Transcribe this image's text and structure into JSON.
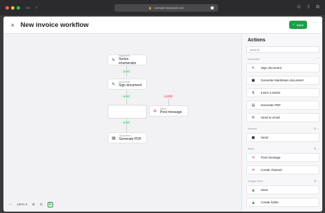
{
  "browser": {
    "url": "console.hexavoir.com",
    "lock": "🔒"
  },
  "header": {
    "close": "×",
    "title": "New invoice workflow",
    "save_label": "Save",
    "save_icon": "✓",
    "more": "···"
  },
  "canvas": {
    "nodes": [
      {
        "category": "Document",
        "label": "Series enumerator",
        "icon": "✎"
      },
      {
        "category": "Document",
        "label": "Sign document",
        "icon": "✎"
      },
      {
        "category": "Slack",
        "label": "Post message",
        "icon": "✲"
      },
      {
        "category": "Document",
        "label": "Generate PDF",
        "icon": "▤"
      }
    ],
    "badges": {
      "ok": "● OK",
      "err": "● ERR"
    },
    "zoom": "100%",
    "zoom_caret": "▾",
    "zoom_minus": "−",
    "zoom_tool1": "⊕",
    "zoom_tool2": "⊖",
    "zoom_tool3": "⊞"
  },
  "panel": {
    "title": "Actions",
    "search_placeholder": "Search",
    "sections": [
      {
        "name": "Document",
        "ctrl": "⌃"
      },
      {
        "name": "Resend",
        "ctrl": "⚙ ⌄"
      },
      {
        "name": "Slack",
        "ctrl": "⚙ ⌄"
      },
      {
        "name": "Google Drive",
        "ctrl": "⚙ ⌄"
      }
    ],
    "actions": [
      {
        "label": "Sign document",
        "icon": "✎"
      },
      {
        "label": "Generate Markdown document",
        "icon": "■"
      },
      {
        "label": "Insert a series",
        "icon": "⇅"
      },
      {
        "label": "Generate PDF",
        "icon": "▤"
      },
      {
        "label": "Send to email",
        "icon": "✉"
      },
      {
        "label": "Send",
        "icon": "■"
      },
      {
        "label": "Post message",
        "icon": "✲"
      },
      {
        "label": "Create channel",
        "icon": "✲"
      },
      {
        "label": "Save",
        "icon": "▲"
      },
      {
        "label": "Create folder",
        "icon": "▲"
      }
    ]
  }
}
